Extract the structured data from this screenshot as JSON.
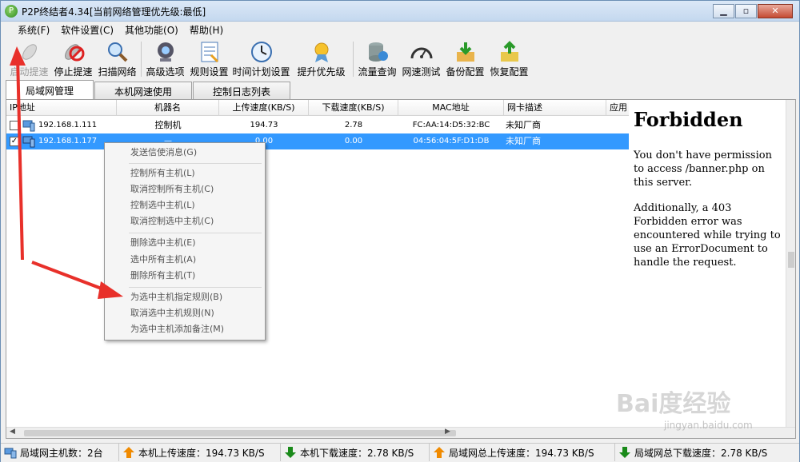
{
  "window": {
    "title": "P2P终结者4.34[当前网络管理优先级:最低]"
  },
  "menu": [
    "系统(F)",
    "软件设置(C)",
    "其他功能(O)",
    "帮助(H)"
  ],
  "toolbar": [
    {
      "label": "启动提速",
      "icon": "rocket-icon",
      "disabled": true
    },
    {
      "label": "停止提速",
      "icon": "stop-icon"
    },
    {
      "label": "扫描网络",
      "icon": "magnifier-icon"
    },
    {
      "label": "高级选项",
      "icon": "webcam-icon"
    },
    {
      "label": "规则设置",
      "icon": "rules-icon"
    },
    {
      "label": "时间计划设置",
      "icon": "clock-icon"
    },
    {
      "label": "提升优先级",
      "icon": "medal-icon"
    },
    {
      "label": "流量查询",
      "icon": "database-icon"
    },
    {
      "label": "网速测试",
      "icon": "gauge-icon"
    },
    {
      "label": "备份配置",
      "icon": "backup-icon"
    },
    {
      "label": "恢复配置",
      "icon": "restore-icon"
    }
  ],
  "tabs": [
    "局域网管理",
    "本机网速使用",
    "控制日志列表"
  ],
  "grid": {
    "headers": [
      "IP地址",
      "机器名",
      "上传速度(KB/S)",
      "下载速度(KB/S)",
      "MAC地址",
      "网卡描述",
      "应用"
    ],
    "rows": [
      {
        "checked": false,
        "ip": "192.168.1.111",
        "name": "控制机",
        "up": "194.73",
        "down": "2.78",
        "mac": "FC:AA:14:D5:32:BC",
        "nic": "未知厂商"
      },
      {
        "checked": true,
        "ip": "192.168.1.177",
        "name": "—",
        "up": "0.00",
        "down": "0.00",
        "mac": "04:56:04:5F:D1:DB",
        "nic": "未知厂商"
      }
    ]
  },
  "context_menu": [
    "发送信使消息(G)",
    "控制所有主机(L)",
    "取消控制所有主机(C)",
    "控制选中主机(L)",
    "取消控制选中主机(C)",
    "删除选中主机(E)",
    "选中所有主机(A)",
    "删除所有主机(T)",
    "为选中主机指定规则(B)",
    "取消选中主机规则(N)",
    "为选中主机添加备注(M)"
  ],
  "forbidden": {
    "title": "Forbidden",
    "p1": "You don't have permission to access /banner.php on this server.",
    "p2": "Additionally, a 403 Forbidden error was encountered while trying to use an ErrorDocument to handle the request."
  },
  "status": {
    "hosts": "局域网主机数：2台",
    "local_up": "本机上传速度：194.73 KB/S",
    "local_down": "本机下载速度：2.78 KB/S",
    "lan_up": "局域网总上传速度：194.73 KB/S",
    "lan_down": "局域网总下载速度：2.78 KB/S"
  },
  "watermark": {
    "logo": "Bai度经验",
    "url": "jingyan.baidu.com"
  },
  "colors": {
    "selection": "#3399ff",
    "annotation_arrow": "#e8302a"
  }
}
